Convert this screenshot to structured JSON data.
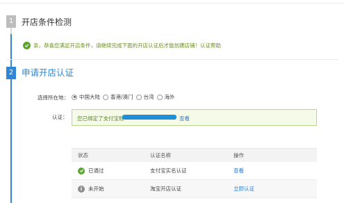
{
  "steps": [
    {
      "number": "1",
      "title": "开店条件检测"
    },
    {
      "number": "2",
      "title": "申请开店认证"
    }
  ],
  "notice": {
    "text": "亲，恭喜您满足开店条件，请继续完成下面的开店认证后才能创建店铺！认证帮助",
    "icon": "check-circle-icon"
  },
  "region": {
    "label": "选择所在地：",
    "options": [
      "中国大陆",
      "香港/澳门",
      "台湾",
      "海外"
    ],
    "selected": "中国大陆"
  },
  "auth": {
    "label": "认证：",
    "message": "您已绑定了支付宝账",
    "view_link": "查看"
  },
  "table": {
    "headers": [
      "状态",
      "认证名称",
      "操作"
    ],
    "rows": [
      {
        "status": "已通过",
        "name": "支付宝实名认证",
        "action": "查看",
        "status_icon": "check-circle-icon"
      },
      {
        "status": "未开始",
        "name": "淘宝开店认证",
        "action": "立即认证",
        "status_icon": "info-circle-icon"
      }
    ]
  },
  "colors": {
    "accent": "#2e86d6",
    "success": "#5aa52f",
    "notice_text": "#6b8e23"
  }
}
